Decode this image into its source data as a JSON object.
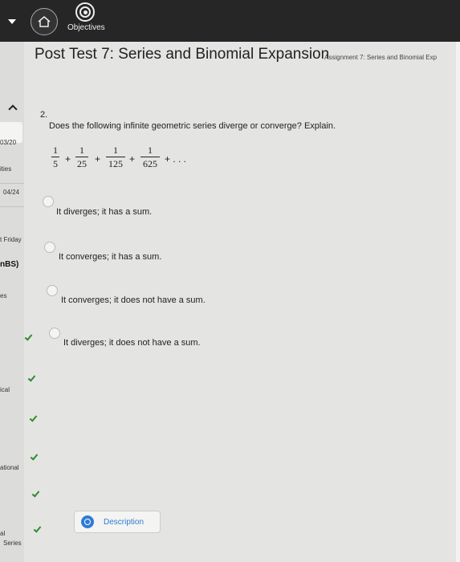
{
  "topbar": {
    "objectives_label": "Objectives"
  },
  "header": {
    "title": "Post Test 7: Series and Binomial Expansion",
    "subtitle": "Assignment 7: Series and Binomial Exp"
  },
  "sidebar": {
    "items": [
      "03/20",
      "ities",
      "04/24",
      "t Friday",
      "nBS)",
      "es",
      "ical",
      "ational",
      "al",
      "Series"
    ]
  },
  "question": {
    "number": "2.",
    "text": "Does the following infinite geometric series diverge or converge? Explain.",
    "terms": [
      {
        "num": "1",
        "den": "5"
      },
      {
        "num": "1",
        "den": "25"
      },
      {
        "num": "1",
        "den": "125"
      },
      {
        "num": "1",
        "den": "625"
      }
    ],
    "plus": "+",
    "ellipsis": "+ . . ."
  },
  "options": [
    "It diverges; it has a sum.",
    "It converges; it has a sum.",
    "It converges; it does not have a sum.",
    "It diverges; it does not have a sum."
  ],
  "description_button": "Description",
  "colors": {
    "check": "#2e8b2e",
    "accent": "#2f7bd6"
  }
}
